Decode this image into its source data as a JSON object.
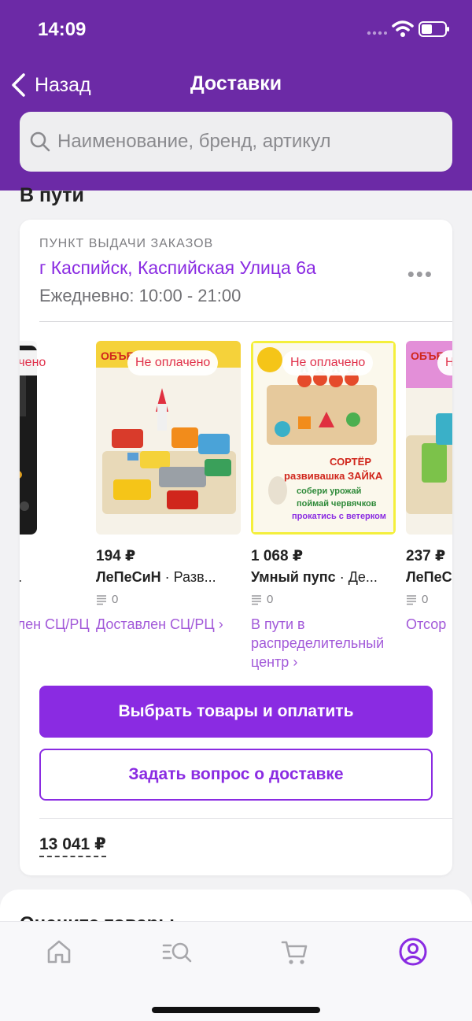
{
  "status_bar": {
    "time": "14:09"
  },
  "nav": {
    "back_label": "Назад",
    "title": "Доставки"
  },
  "search": {
    "placeholder": "Наименование, бренд, артикул"
  },
  "section": {
    "title": "В пути"
  },
  "delivery": {
    "pickup_label": "ПУНКТ ВЫДАЧИ ЗАКАЗОВ",
    "address": "г Каспийск, Каспийская Улица 6а",
    "hours": "Ежедневно: 10:00 - 21:00",
    "products": [
      {
        "badge": "Не оплачено",
        "brand_line": "т. · Эл...",
        "rating": "",
        "status": "Доставлен СЦ/РЦ"
      },
      {
        "badge": "Не оплачено",
        "price": "194 ₽",
        "brand": "ЛеПеСиН",
        "desc": " · Разв...",
        "rating": "0",
        "status": "Доставлен СЦ/РЦ ›"
      },
      {
        "badge": "Не оплачено",
        "price": "1 068 ₽",
        "brand": "Умный пупс",
        "desc": " · Де...",
        "rating": "0",
        "status": "В пути в распределительный центр ›"
      },
      {
        "badge": "Не оплачено",
        "price": "237 ₽",
        "brand": "ЛеПеС",
        "desc": "",
        "rating": "0",
        "status": "Отсор"
      }
    ],
    "pay_button": "Выбрать товары и оплатить",
    "ask_button": "Задать вопрос о доставке",
    "total": "13 041 ₽"
  },
  "peek": {
    "title": "Оцените товары"
  },
  "colors": {
    "brand": "#6c2aa6",
    "accent": "#8a2be2",
    "badge": "#e0304a"
  },
  "tabbar": {
    "active": "profile-icon",
    "icons": [
      "home-icon",
      "catalog-search-icon",
      "cart-icon",
      "profile-icon"
    ]
  }
}
